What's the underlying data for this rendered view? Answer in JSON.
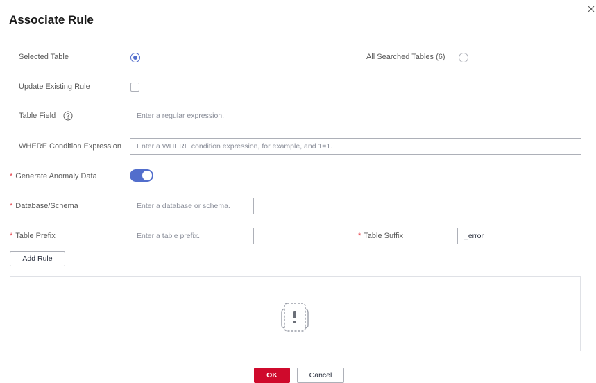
{
  "dialog": {
    "title": "Associate Rule"
  },
  "scope": {
    "selected_table_label": "Selected Table",
    "all_searched_label": "All Searched Tables (6)",
    "selected_value": "Selected Table"
  },
  "update_existing": {
    "label": "Update Existing Rule",
    "checked": false
  },
  "table_field": {
    "label": "Table Field",
    "placeholder": "Enter a regular expression.",
    "value": ""
  },
  "where_condition": {
    "label": "WHERE Condition Expression",
    "placeholder": "Enter a WHERE condition expression, for example, and 1=1.",
    "value": ""
  },
  "generate_anomaly": {
    "required_mark": "*",
    "label": "Generate Anomaly Data",
    "enabled": true
  },
  "database_schema": {
    "required_mark": "*",
    "label": "Database/Schema",
    "placeholder": "Enter a database or schema.",
    "value": ""
  },
  "table_prefix": {
    "required_mark": "*",
    "label": "Table Prefix",
    "placeholder": "Enter a table prefix.",
    "value": ""
  },
  "table_suffix": {
    "required_mark": "*",
    "label": "Table Suffix",
    "value": "_error"
  },
  "add_rule_label": "Add Rule",
  "footer": {
    "ok_label": "OK",
    "cancel_label": "Cancel"
  },
  "colors": {
    "accent": "#526ecc",
    "primary_button": "#cf0a2c",
    "required": "#e6424c"
  }
}
